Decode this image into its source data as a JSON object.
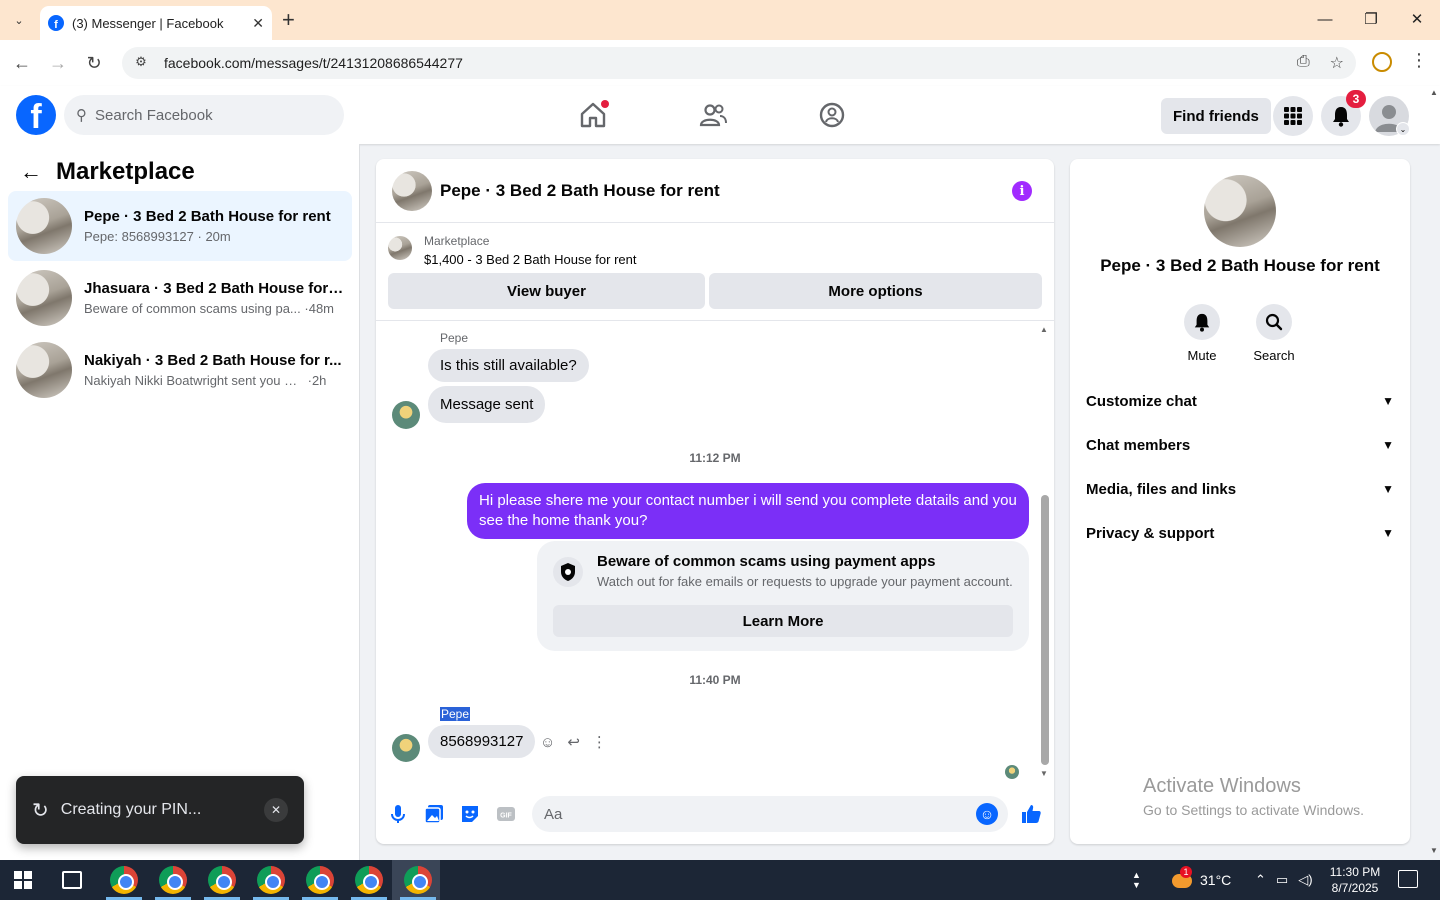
{
  "browser": {
    "tab_title": "(3) Messenger | Facebook",
    "url": "facebook.com/messages/t/24131208686544277"
  },
  "header": {
    "search_placeholder": "Search Facebook",
    "find_friends": "Find friends",
    "notification_count": "3"
  },
  "left": {
    "title": "Marketplace",
    "conversations": [
      {
        "name": "Pepe · 3 Bed 2 Bath House for rent",
        "preview": "Pepe: 8568993127",
        "time": "20m",
        "active": true
      },
      {
        "name": "Jhasuara · 3 Bed 2 Bath House for ...",
        "preview": "Beware of common scams using pa...",
        "time": "48m",
        "active": false
      },
      {
        "name": "Nakiyah · 3 Bed 2 Bath House for r...",
        "preview": "Nakiyah Nikki Boatwright sent you a ...",
        "time": "2h",
        "active": false
      }
    ]
  },
  "toast": {
    "message": "Creating your PIN..."
  },
  "chat": {
    "title": "Pepe · 3 Bed 2 Bath House for rent",
    "marketplace_label": "Marketplace",
    "listing": "$1,400 - 3 Bed 2 Bath House for rent",
    "view_buyer": "View buyer",
    "more_options": "More options",
    "sender": "Pepe",
    "msg1": "Is this still available?",
    "msg2": "Message sent",
    "time1": "11:12 PM",
    "out_msg": "Hi please shere me your contact number i will send you complete datails and you see the home thank you?",
    "scam_title": "Beware of common scams using payment apps",
    "scam_body": "Watch out for fake emails or requests to upgrade your payment account.",
    "learn_more": "Learn More",
    "time2": "11:40 PM",
    "sender2": "Pepe",
    "msg3": "8568993127",
    "composer_placeholder": "Aa"
  },
  "right": {
    "title": "Pepe · 3 Bed 2 Bath House for rent",
    "mute": "Mute",
    "search": "Search",
    "sections": [
      "Customize chat",
      "Chat members",
      "Media, files and links",
      "Privacy & support"
    ]
  },
  "watermark": {
    "line1": "Activate Windows",
    "line2": "Go to Settings to activate Windows."
  },
  "taskbar": {
    "weather": "31°C",
    "weather_badge": "1",
    "time": "11:30 PM",
    "date": "8/7/2025"
  },
  "colors": {
    "fb_blue": "#0866ff",
    "outgoing_bubble": "#7b2ff7",
    "badge_red": "#e41e3f"
  }
}
